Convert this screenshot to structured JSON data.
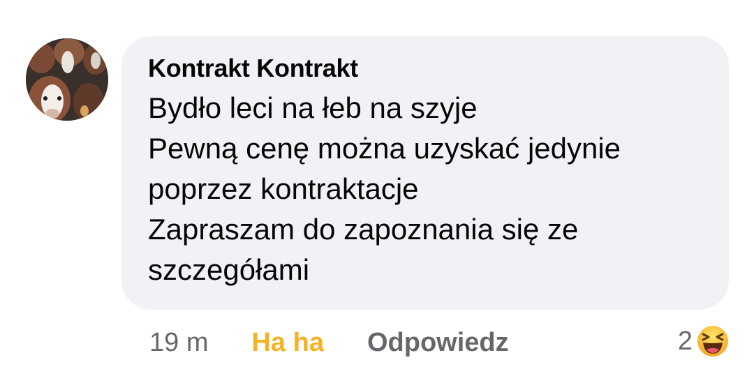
{
  "comment": {
    "author": "Kontrakt Kontrakt",
    "lines": [
      "Bydło leci na łeb na szyje",
      "Pewną cenę można uzyskać jedynie",
      "poprzez kontraktacje",
      "Zapraszam do zapoznania się ze",
      "szczegółami"
    ],
    "avatar_icon": "cattle-photo-avatar"
  },
  "actions": {
    "time": "19 m",
    "reaction_label": "Ha ha",
    "reply_label": "Odpowiedz"
  },
  "reactions": {
    "count": "2",
    "icon": "haha-emoji-icon"
  },
  "colors": {
    "bubble": "#f0f2f5",
    "text": "#050505",
    "muted": "#65676b",
    "haha": "#f7b125"
  }
}
